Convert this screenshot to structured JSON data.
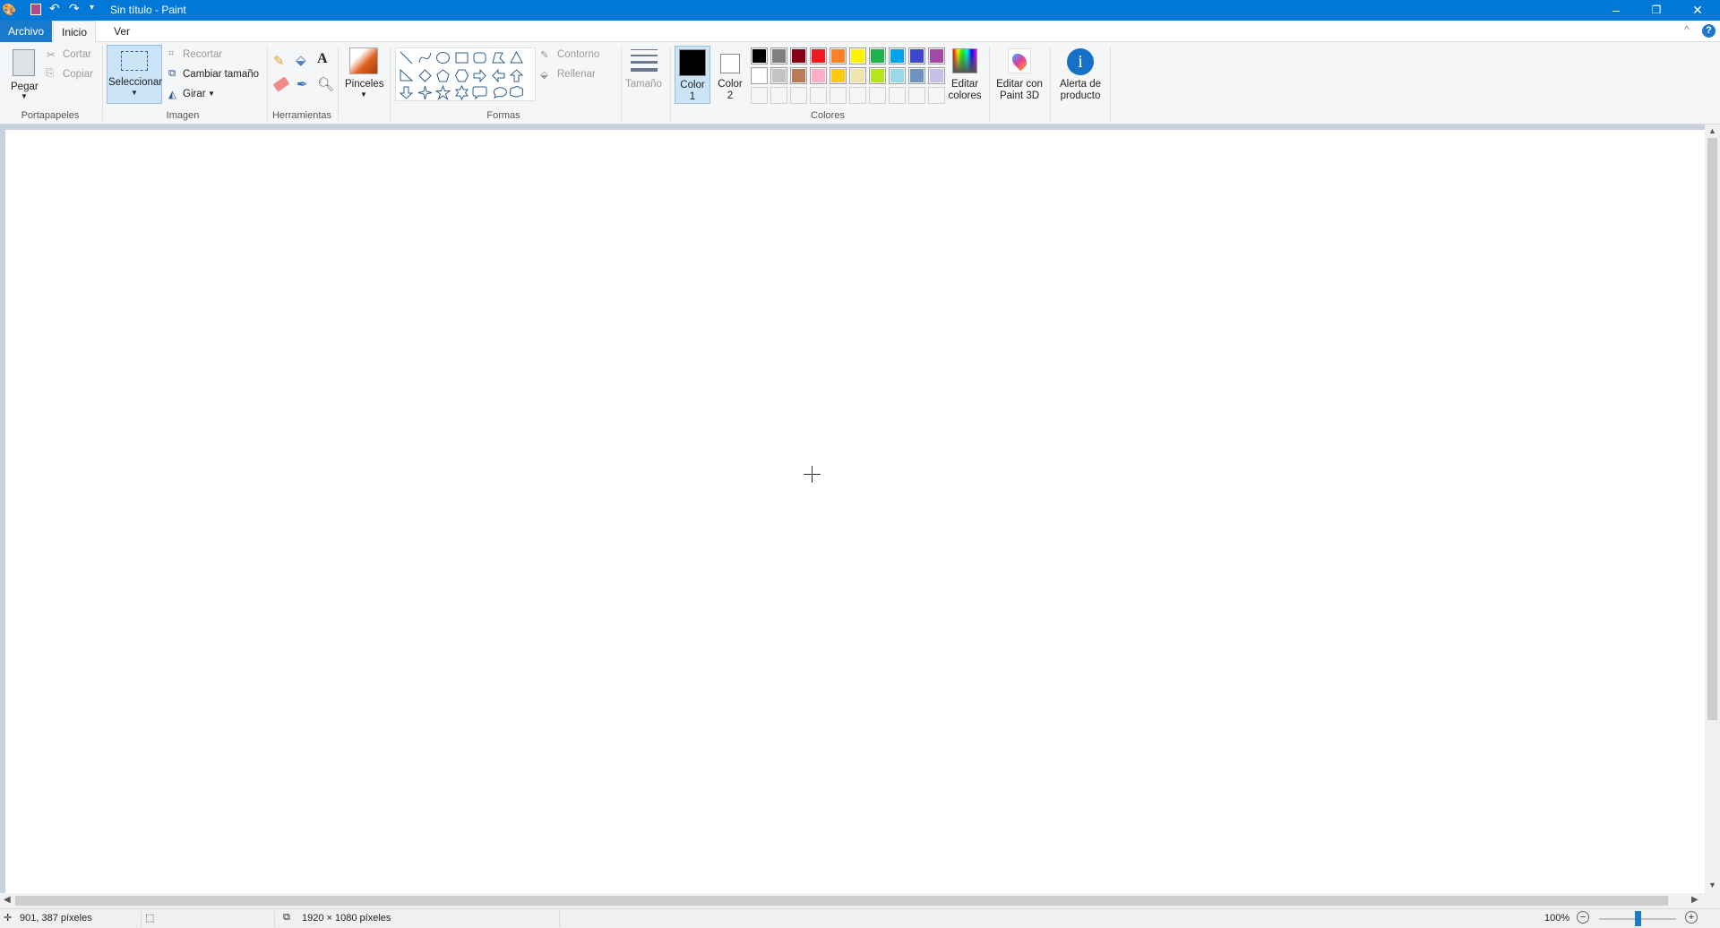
{
  "window": {
    "title": "Sin título - Paint",
    "minimize": "–",
    "maximize": "❐",
    "close": "✕",
    "collapse": "^",
    "help": "?"
  },
  "tabs": [
    {
      "label": "Archivo"
    },
    {
      "label": "Inicio"
    },
    {
      "label": "Ver"
    }
  ],
  "ribbon": {
    "clipboard": {
      "paste": "Pegar",
      "cut": "Cortar",
      "copy": "Copiar",
      "group": "Portapapeles"
    },
    "image": {
      "select": "Seleccionar",
      "crop": "Recortar",
      "resize": "Cambiar tamaño",
      "rotate": "Girar",
      "group": "Imagen"
    },
    "tools": {
      "group": "Herramientas",
      "icons": [
        "pencil-icon",
        "fill-icon",
        "text-icon",
        "eraser-icon",
        "color-picker-icon",
        "magnifier-icon"
      ]
    },
    "brushes": {
      "label": "Pinceles"
    },
    "shapes": {
      "group": "Formas",
      "outline": "Contorno",
      "fill": "Rellenar",
      "items": [
        "line",
        "curve",
        "oval",
        "rectangle",
        "rounded-rectangle",
        "polygon",
        "triangle",
        "right-triangle",
        "diamond",
        "pentagon",
        "hexagon",
        "right-arrow",
        "left-arrow",
        "up-arrow",
        "down-arrow",
        "four-point-star",
        "five-point-star",
        "six-point-star",
        "rounded-callout",
        "oval-callout",
        "cloud-callout"
      ]
    },
    "size": {
      "label": "Tamaño"
    },
    "colors": {
      "color1": "Color",
      "color1_num": "1",
      "color2": "Color",
      "color2_num": "2",
      "group": "Colores",
      "edit_line1": "Editar",
      "edit_line2": "colores",
      "color1_value": "#000000",
      "color2_value": "#ffffff",
      "palette": [
        "#000000",
        "#7f7f7f",
        "#880015",
        "#ed1c24",
        "#ff7f27",
        "#fff200",
        "#22b14c",
        "#00a2e8",
        "#3f48cc",
        "#a349a4",
        "#ffffff",
        "#c3c3c3",
        "#b97a57",
        "#ffaec9",
        "#ffc90e",
        "#efe4b0",
        "#b5e61d",
        "#99d9ea",
        "#7092be",
        "#c8bfe7"
      ],
      "empty_slots": 10
    },
    "paint3d": {
      "line1": "Editar con",
      "line2": "Paint 3D"
    },
    "alert": {
      "line1": "Alerta de",
      "line2": "producto"
    }
  },
  "status": {
    "cursor": "901, 387 píxeles",
    "size": "1920 × 1080 píxeles",
    "zoom": "100%",
    "zoom_percent": 100
  }
}
